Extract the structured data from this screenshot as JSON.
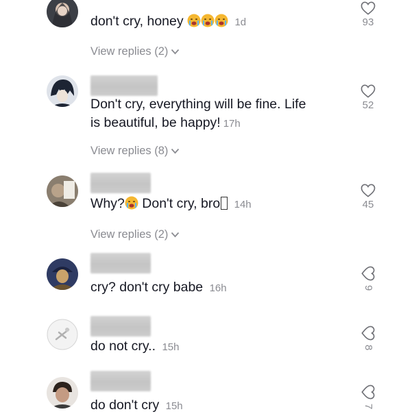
{
  "comments": [
    {
      "avatar_icon": "user-avatar-icon",
      "text": "don't cry, honey",
      "emoji": [
        "crying-face-emoji",
        "crying-face-emoji",
        "crying-face-emoji"
      ],
      "time": "1d",
      "likes": "93",
      "view_replies": "View replies (2)"
    },
    {
      "avatar_icon": "user-avatar-icon",
      "text_line1": "Don't cry, everything will be fine. Life",
      "text_line2": "is beautiful, be happy!",
      "time": "17h",
      "likes": "52",
      "view_replies": "View replies (8)"
    },
    {
      "avatar_icon": "user-avatar-icon",
      "text_before": "Why?",
      "emoji": [
        "crying-face-emoji"
      ],
      "text_after": "Don't cry, bro",
      "time": "14h",
      "likes": "45",
      "view_replies": "View replies (2)"
    },
    {
      "avatar_icon": "user-avatar-icon",
      "text": "cry? don't cry babe",
      "time": "16h",
      "likes": "9"
    },
    {
      "avatar_icon": "user-avatar-icon",
      "text": "do not cry..",
      "time": "15h",
      "likes": "8"
    },
    {
      "avatar_icon": "user-avatar-icon",
      "text": "do don't cry",
      "time": "15h",
      "likes": "7"
    }
  ],
  "colors": {
    "text": "#161823",
    "muted": "#8a8b91",
    "emoji": "#f5b731"
  },
  "icons": {
    "like": "heart-outline-icon",
    "expand": "chevron-down-icon"
  }
}
